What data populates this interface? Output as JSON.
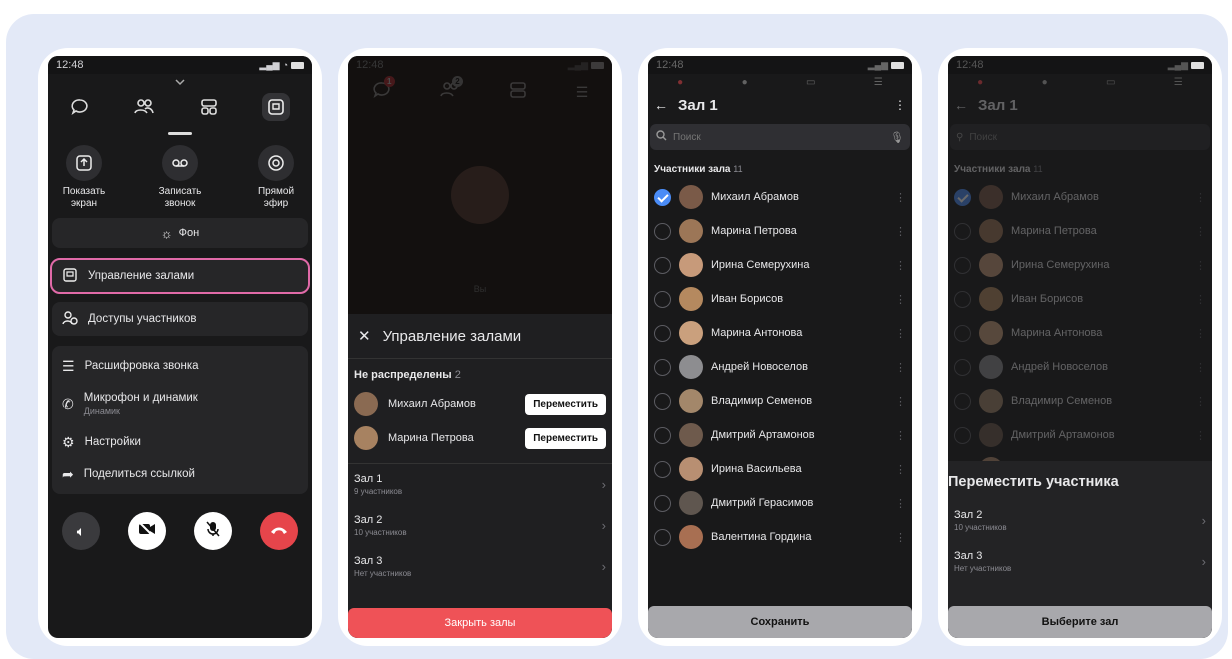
{
  "time": "12:48",
  "colors": {
    "accent_red": "#e6454b",
    "accent_blue": "#4a8cf7",
    "highlight_pink": "#e06aa8",
    "panel": "#262628"
  },
  "screen1": {
    "actions": [
      {
        "label": "Показать\nэкран",
        "icon": "share-screen-icon"
      },
      {
        "label": "Записать\nзвонок",
        "icon": "record-icon"
      },
      {
        "label": "Прямой\nэфир",
        "icon": "broadcast-icon"
      }
    ],
    "background_label": "Фон",
    "menu": {
      "rooms": "Управление залами",
      "access": "Доступы участников",
      "transcript": "Расшифровка звонка",
      "mic": "Микрофон и динамик",
      "mic_sub": "Динамик",
      "settings": "Настройки",
      "share": "Поделиться ссылкой"
    }
  },
  "screen2": {
    "badge_chat": "1",
    "badge_people": "2",
    "you_label": "Вы",
    "title": "Управление залами",
    "unassigned_label": "Не распределены",
    "unassigned_count": "2",
    "unassigned": [
      {
        "name": "Михаил Абрамов",
        "action": "Переместить"
      },
      {
        "name": "Марина Петрова",
        "action": "Переместить"
      }
    ],
    "rooms": [
      {
        "name": "Зал 1",
        "sub": "9 участников"
      },
      {
        "name": "Зал 2",
        "sub": "10 участников"
      },
      {
        "name": "Зал 3",
        "sub": "Нет участников"
      }
    ],
    "close_button": "Закрыть залы"
  },
  "screen3": {
    "title": "Зал 1",
    "search_placeholder": "Поиск",
    "members_label": "Участники зала",
    "members_count": "11",
    "members": [
      "Михаил Абрамов",
      "Марина Петрова",
      "Ирина Семерухина",
      "Иван Борисов",
      "Марина Антонова",
      "Андрей Новоселов",
      "Владимир Семенов",
      "Дмитрий Артамонов",
      "Ирина Васильева",
      "Дмитрий Герасимов",
      "Валентина Гордина"
    ],
    "save_button": "Сохранить"
  },
  "screen4": {
    "sheet_title": "Переместить участника",
    "rooms": [
      {
        "name": "Зал 2",
        "sub": "10 участников"
      },
      {
        "name": "Зал 3",
        "sub": "Нет участников"
      }
    ],
    "select_button": "Выберите зал"
  }
}
